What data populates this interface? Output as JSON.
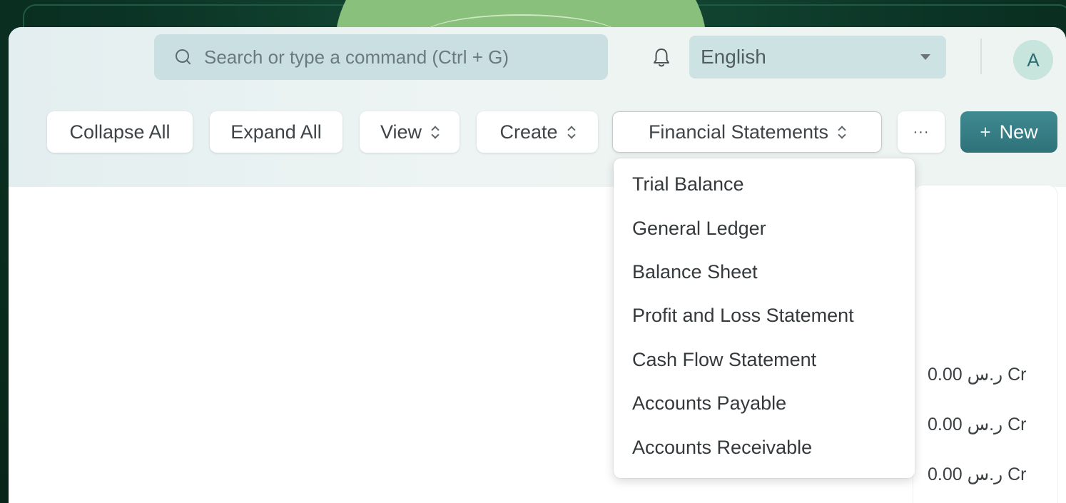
{
  "header": {
    "search_placeholder": "Search or type a command (Ctrl + G)",
    "language": "English",
    "avatar_initial": "A"
  },
  "toolbar": {
    "collapse_all": "Collapse All",
    "expand_all": "Expand All",
    "view": "View",
    "create": "Create",
    "financial_statements": "Financial Statements",
    "more": "···",
    "new_label": "New",
    "new_plus": "+"
  },
  "menu": {
    "items": [
      "Trial Balance",
      "General Ledger",
      "Balance Sheet",
      "Profit and Loss Statement",
      "Cash Flow Statement",
      "Accounts Payable",
      "Accounts Receivable"
    ]
  },
  "balances": [
    "0.00 ر.س Cr",
    "0.00 ر.س Cr",
    "0.00 ر.س Cr"
  ],
  "colors": {
    "primary_button": "#2f7279",
    "backdrop": "#0b3325",
    "accent_circle": "#88c07c"
  }
}
